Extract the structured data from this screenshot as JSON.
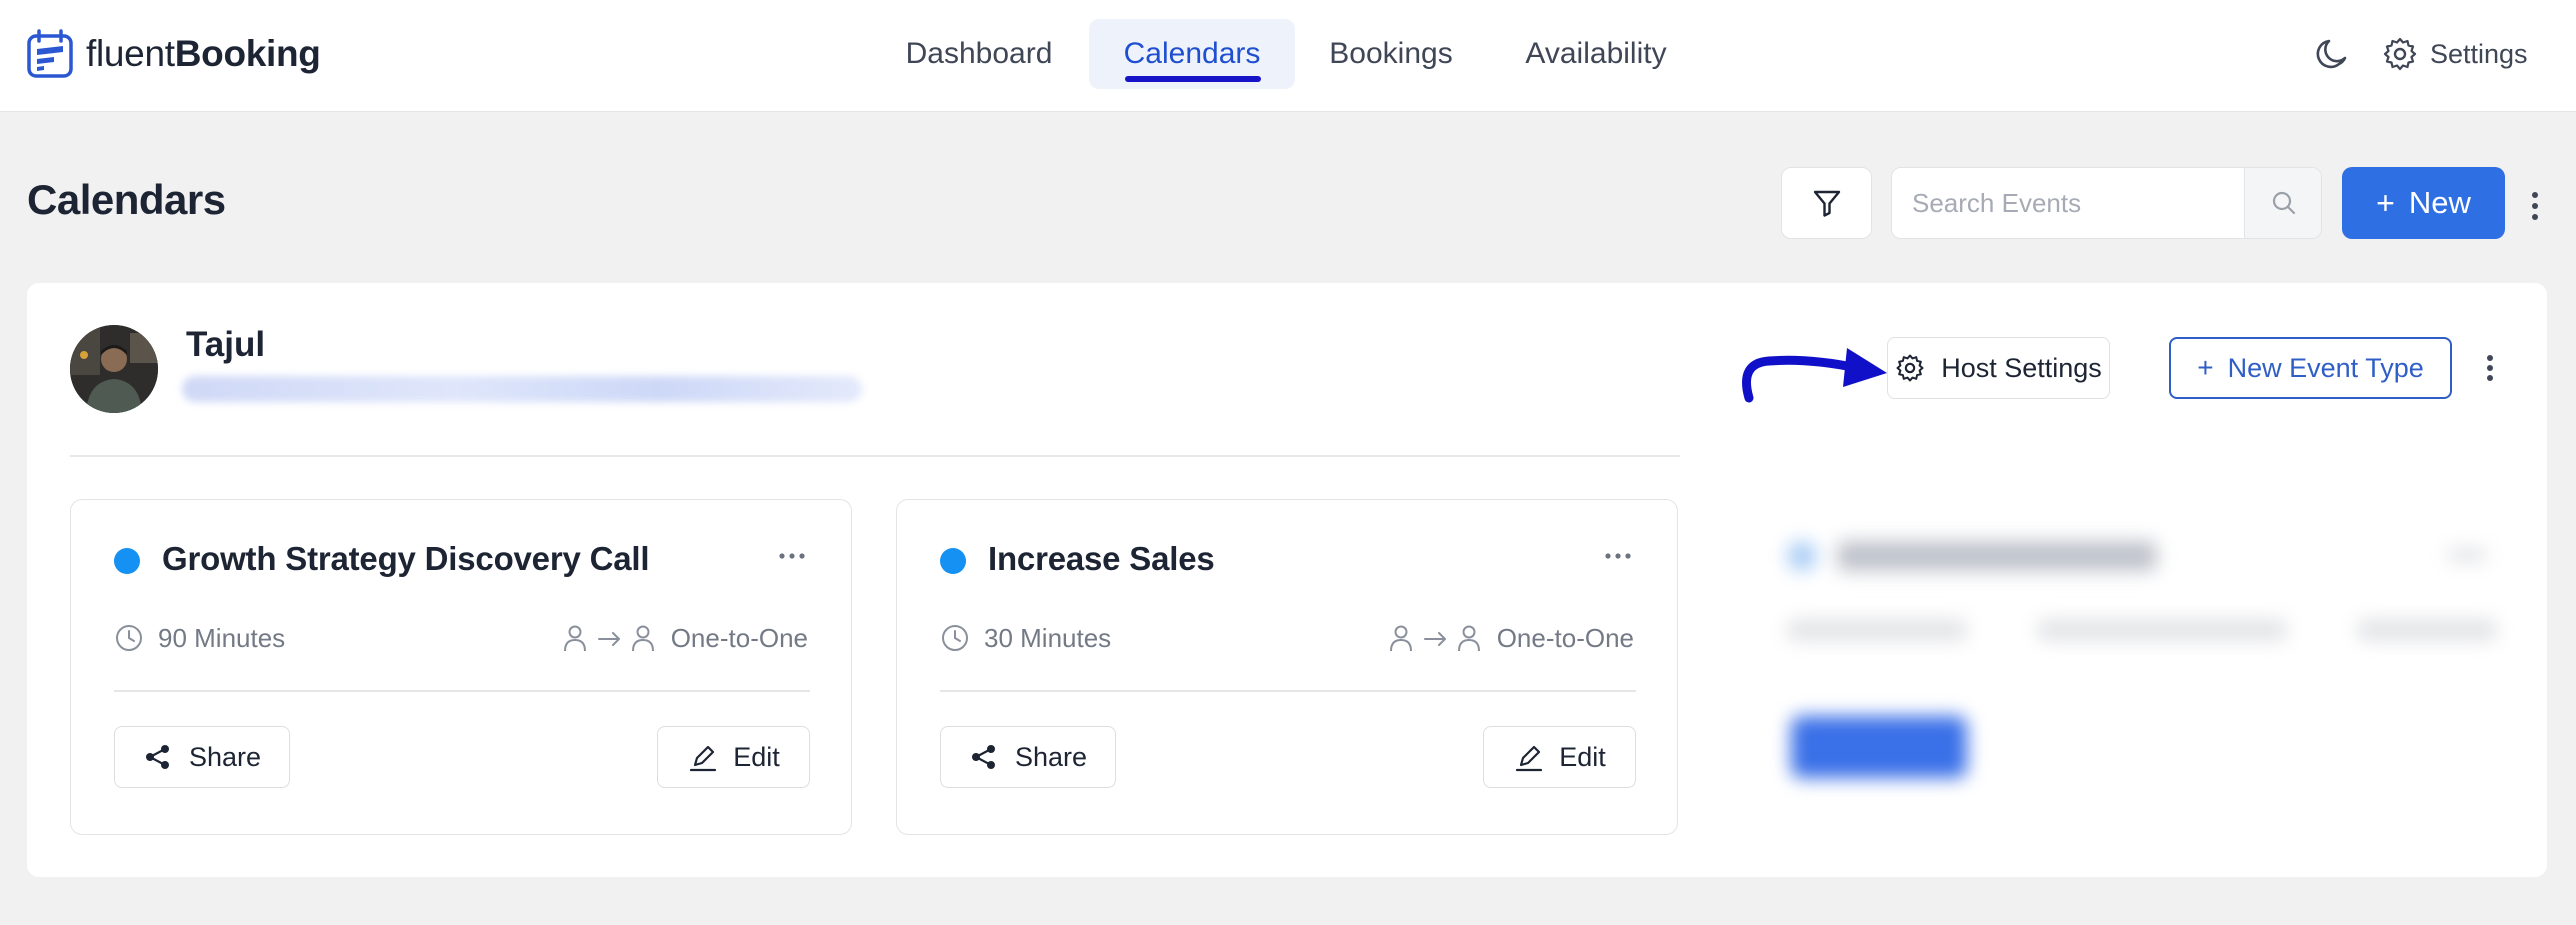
{
  "app": {
    "logo_light": "fluent",
    "logo_bold": "Booking"
  },
  "nav": {
    "items": [
      {
        "label": "Dashboard"
      },
      {
        "label": "Calendars"
      },
      {
        "label": "Bookings"
      },
      {
        "label": "Availability"
      }
    ],
    "active_index": 1,
    "settings_label": "Settings",
    "theme_icon": "moon-icon"
  },
  "page": {
    "title": "Calendars",
    "search_placeholder": "Search Events",
    "new_label": "New"
  },
  "calendar": {
    "host_name": "Tajul",
    "host_settings_label": "Host Settings",
    "new_event_type_label": "New Event Type",
    "events": [
      {
        "title": "Growth Strategy Discovery Call",
        "duration": "90 Minutes",
        "meeting_type": "One-to-One",
        "share_label": "Share",
        "edit_label": "Edit",
        "dot_color": "#1491f2"
      },
      {
        "title": "Increase Sales",
        "duration": "30 Minutes",
        "meeting_type": "One-to-One",
        "share_label": "Share",
        "edit_label": "Edit",
        "dot_color": "#1491f2"
      }
    ]
  },
  "colors": {
    "accent": "#2f6fe4",
    "nav_active": "#1f4ed0",
    "underline": "#1713c9",
    "annotation_arrow": "#1010c8"
  }
}
